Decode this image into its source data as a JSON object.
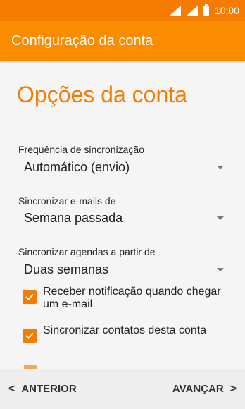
{
  "status_bar": {
    "time": "10:00",
    "icons": [
      "signal-icon",
      "signal-icon",
      "battery-icon"
    ]
  },
  "app_bar": {
    "title": "Configuração da conta"
  },
  "page_title": "Opções da conta",
  "settings": {
    "sync_frequency": {
      "label": "Frequência de sincronização",
      "value": "Automático (envio)"
    },
    "sync_emails": {
      "label": "Sincronizar e-mails de",
      "value": "Semana passada"
    },
    "sync_calendars": {
      "label": "Sincronizar agendas a partir de",
      "value": "Duas semanas"
    }
  },
  "checkboxes": [
    {
      "label": "Receber notificação quando chegar um e-mail",
      "checked": true
    },
    {
      "label": "Sincronizar contatos desta conta",
      "checked": true
    }
  ],
  "bottom_nav": {
    "prev_label": "ANTERIOR",
    "next_label": "AVANÇAR",
    "prev_icon": "chevron-left-icon",
    "next_icon": "chevron-right-icon"
  },
  "colors": {
    "accent": "#f57c00",
    "app_bar": "#fb8c00",
    "background": "#f5f5f5",
    "bottom_bar": "#eeeeee"
  }
}
